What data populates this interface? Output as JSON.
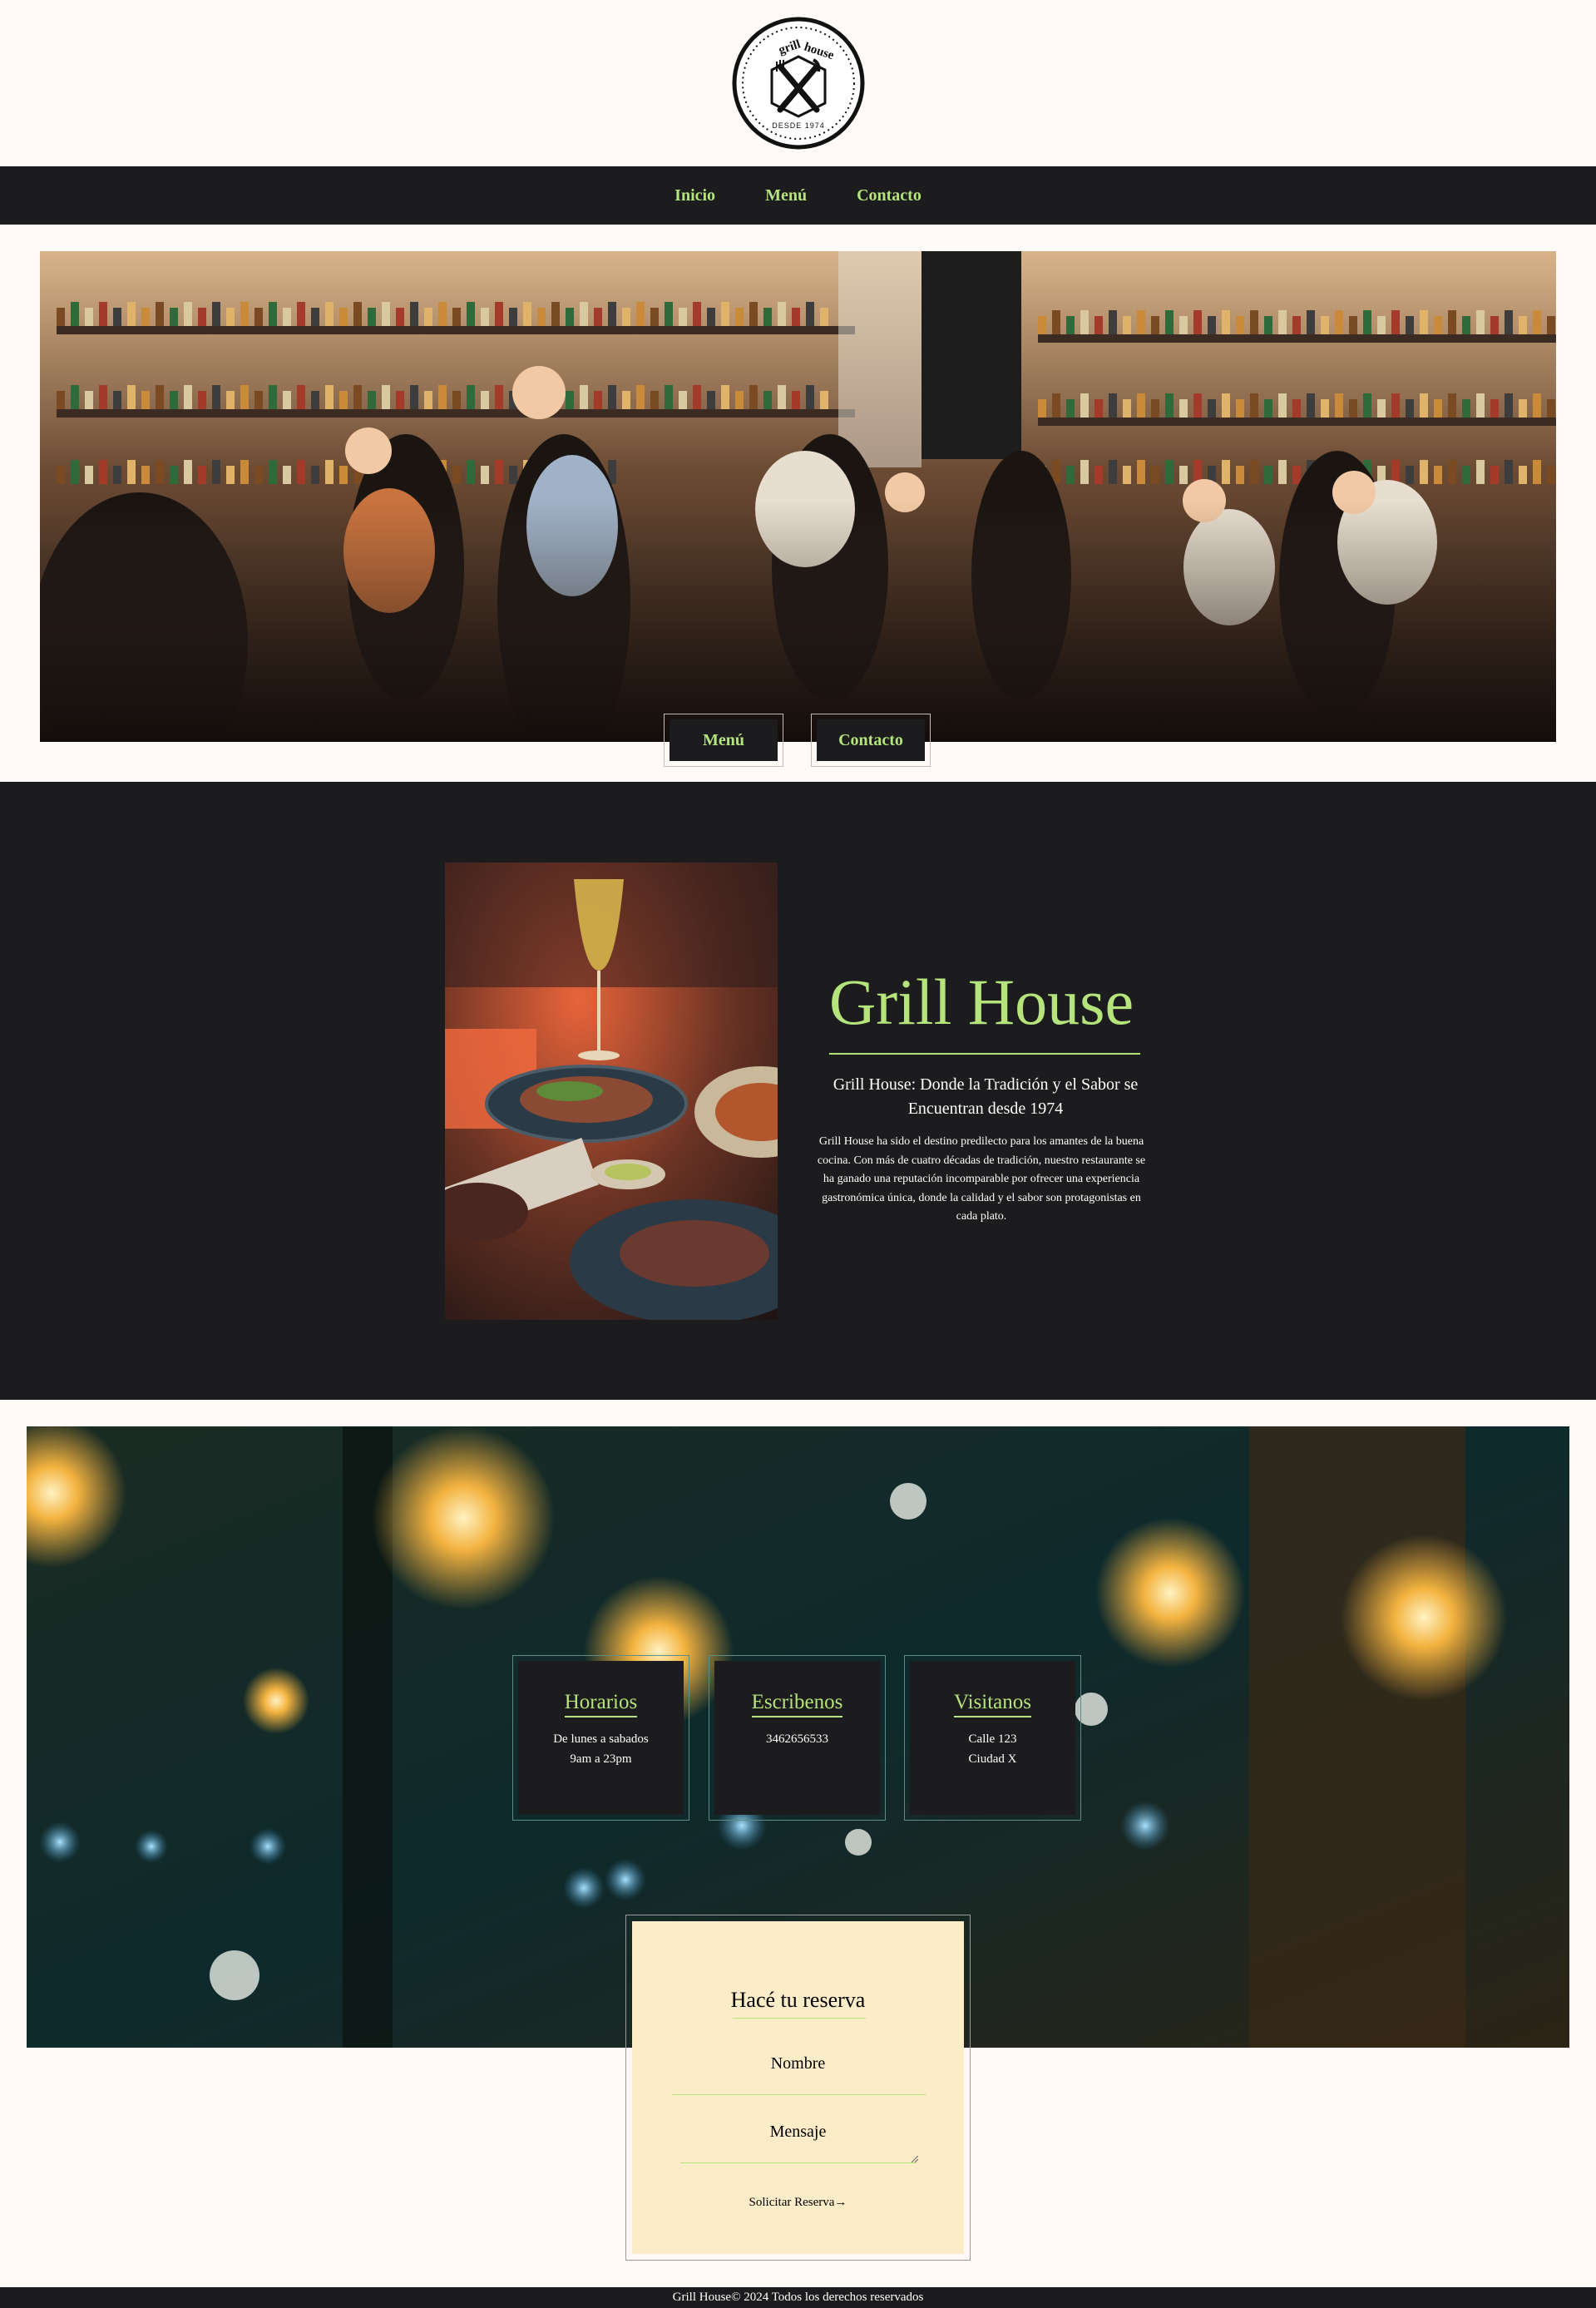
{
  "brand": {
    "logo_text_top_left": "grill",
    "logo_text_top_right": "house",
    "logo_text_bottom": "DESDE 1974"
  },
  "nav": {
    "items": [
      {
        "label": "Inicio"
      },
      {
        "label": "Menú"
      },
      {
        "label": "Contacto"
      }
    ]
  },
  "hero": {
    "buttons": [
      {
        "label": "Menú"
      },
      {
        "label": "Contacto"
      }
    ]
  },
  "about": {
    "title": "Grill House",
    "subtitle": "Grill House: Donde la Tradición y el Sabor se Encuentran desde 1974",
    "body": "Grill House ha sido el destino predilecto para los amantes de la buena cocina. Con más de cuatro décadas de tradición, nuestro restaurante se ha ganado una reputación incomparable por ofrecer una experiencia gastronómica única, donde la calidad y el sabor son protagonistas en cada plato."
  },
  "info": {
    "cards": [
      {
        "title": "Horarios",
        "line1": "De lunes a sabados",
        "line2": "9am a 23pm"
      },
      {
        "title": "Escribenos",
        "line1": "3462656533",
        "line2": ""
      },
      {
        "title": "Visitanos",
        "line1": "Calle 123",
        "line2": "Ciudad X"
      }
    ]
  },
  "reservation": {
    "title": "Hacé tu reserva",
    "name_label": "Nombre",
    "message_label": "Mensaje",
    "submit_label": "Solicitar Reserva→"
  },
  "footer": {
    "text": "Grill House© 2024 Todos los derechos reservados"
  },
  "colors": {
    "accent": "#b5e37c",
    "dark": "#1c1b1d",
    "cream": "#fdecc8",
    "page_bg": "#fffaf7"
  }
}
